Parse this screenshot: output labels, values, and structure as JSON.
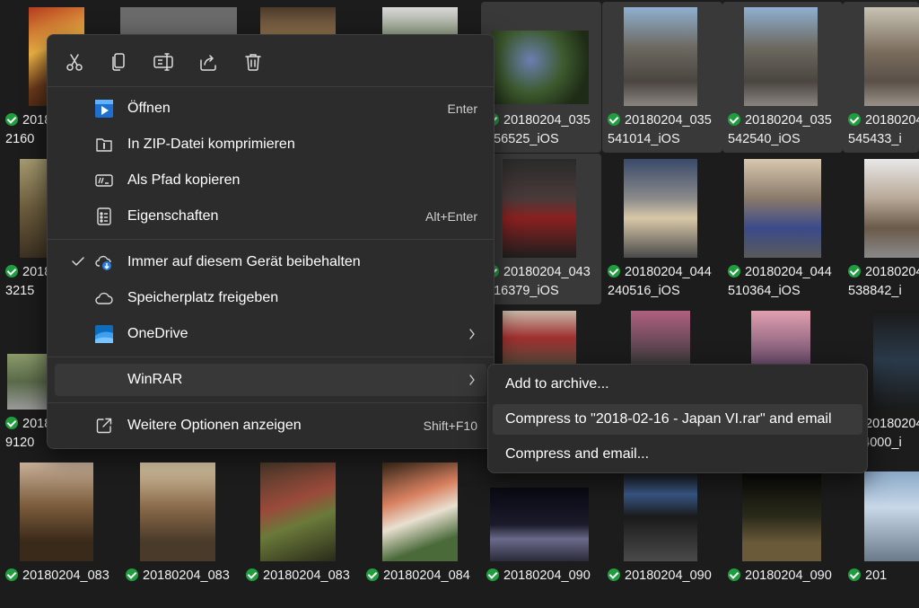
{
  "grid": {
    "check_color": "#1f9d3f",
    "tiles": [
      {
        "l1": "2018",
        "l2": "2160"
      },
      {
        "l1": "20180204_035",
        "l2": "456525_iOS"
      },
      {
        "l1": "20180204_035",
        "l2": "541014_iOS"
      },
      {
        "l1": "20180204_035",
        "l2": "542540_iOS"
      },
      {
        "l1": "20180204_0",
        "l2": "545433_i"
      },
      {
        "l1": "2018",
        "l2": "3215"
      },
      {
        "l1": "20180204_043",
        "l2": "616379_iOS"
      },
      {
        "l1": "20180204_044",
        "l2": "240516_iOS"
      },
      {
        "l1": "20180204_044",
        "l2": "510364_iOS"
      },
      {
        "l1": "20180204_0",
        "l2": "538842_i"
      },
      {
        "l1": "2018",
        "l2": "9120"
      },
      {
        "l1": "20180204_0",
        "l2": "914000_i"
      },
      {
        "l1": "20180204_083",
        "l2": ""
      },
      {
        "l1": "20180204_083",
        "l2": ""
      },
      {
        "l1": "20180204_083",
        "l2": ""
      },
      {
        "l1": "20180204_084",
        "l2": ""
      },
      {
        "l1": "20180204_090",
        "l2": ""
      },
      {
        "l1": "20180204_090",
        "l2": ""
      },
      {
        "l1": "20180204_090",
        "l2": ""
      },
      {
        "l1": "201",
        "l2": ""
      }
    ]
  },
  "context_menu": {
    "toolbar": [
      {
        "icon": "cut-icon"
      },
      {
        "icon": "copy-icon"
      },
      {
        "icon": "rename-icon"
      },
      {
        "icon": "share-icon"
      },
      {
        "icon": "delete-icon"
      }
    ],
    "items": [
      {
        "label": "Öffnen",
        "shortcut": "Enter",
        "icon": "open-icon"
      },
      {
        "label": "In ZIP-Datei komprimieren",
        "shortcut": "",
        "icon": "zip-folder-icon"
      },
      {
        "label": "Als Pfad kopieren",
        "shortcut": "",
        "icon": "copy-path-icon"
      },
      {
        "label": "Eigenschaften",
        "shortcut": "Alt+Enter",
        "icon": "properties-icon"
      },
      {
        "label": "Immer auf diesem Gerät beibehalten",
        "shortcut": "",
        "icon": "cloud-download-icon",
        "checked": true
      },
      {
        "label": "Speicherplatz freigeben",
        "shortcut": "",
        "icon": "cloud-icon"
      },
      {
        "label": "OneDrive",
        "shortcut": "",
        "icon": "onedrive-icon",
        "submenu": true
      },
      {
        "label": "WinRAR",
        "shortcut": "",
        "icon": "",
        "submenu": true,
        "highlighted": true
      },
      {
        "label": "Weitere Optionen anzeigen",
        "shortcut": "Shift+F10",
        "icon": "more-options-icon"
      }
    ]
  },
  "winrar_submenu": {
    "items": [
      {
        "label": "Add to archive..."
      },
      {
        "label": "Compress to \"2018-02-16 - Japan VI.rar\" and email",
        "highlighted": true
      },
      {
        "label": "Compress and email..."
      }
    ]
  }
}
